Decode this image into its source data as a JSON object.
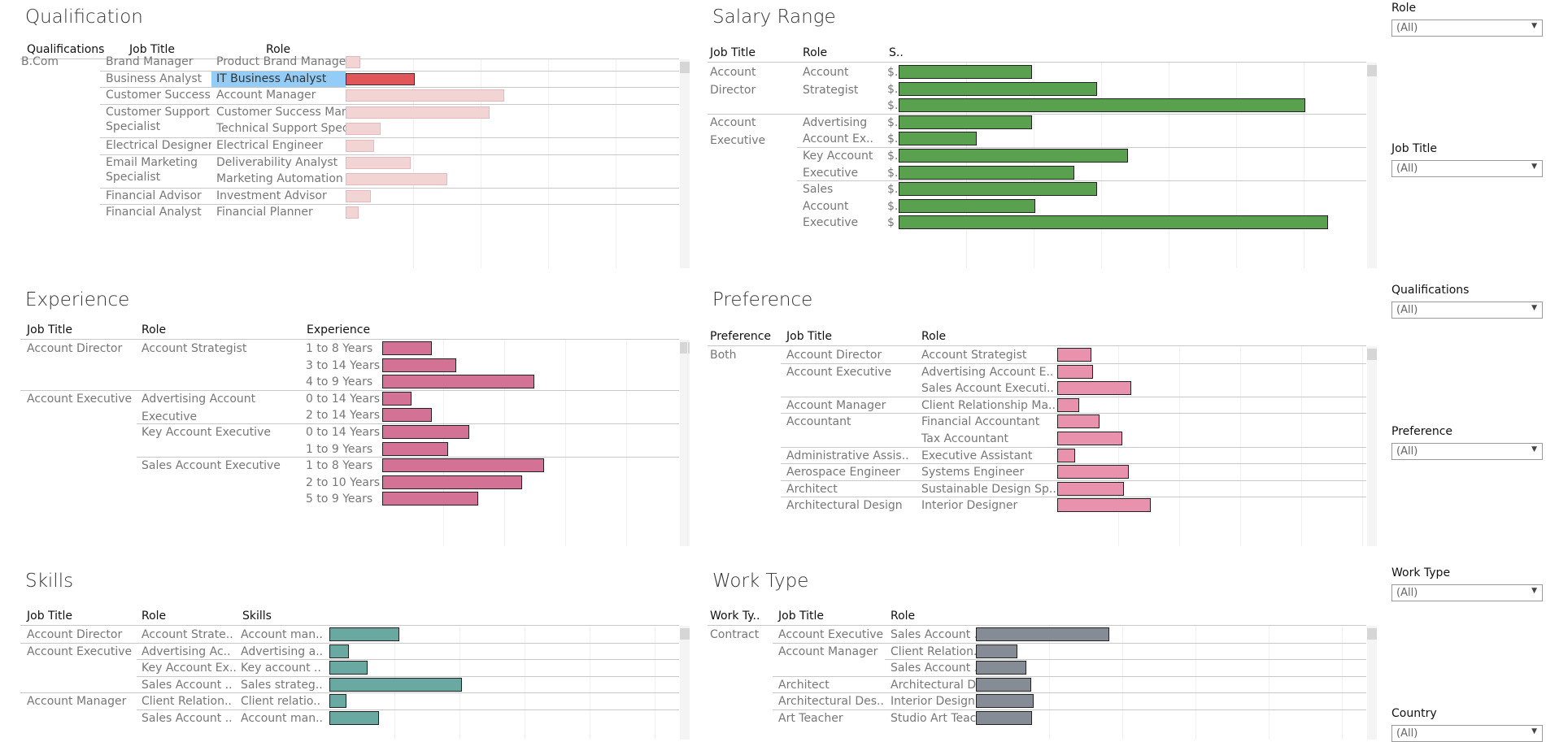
{
  "qualification": {
    "title": "Qualification",
    "headers": [
      "Qualifications",
      "Job Title",
      "Role"
    ],
    "rows": [
      {
        "qual": "B.Com",
        "job": "Brand Manager",
        "job2": "",
        "role": "Product Brand Manager",
        "value": 22
      },
      {
        "qual": "",
        "job": "Business Analyst",
        "job2": "",
        "role": "IT Business Analyst",
        "value": 104
      },
      {
        "qual": "",
        "job": "Customer Success M..",
        "job2": "",
        "role": "Account Manager",
        "value": 238
      },
      {
        "qual": "",
        "job": "Customer Support",
        "job2": "Specialist",
        "role": "Customer Success Manag..",
        "value": 216
      },
      {
        "qual": "",
        "job": "",
        "job2": "",
        "role": "Technical Support Special..",
        "value": 52
      },
      {
        "qual": "",
        "job": "Electrical Designer",
        "job2": "",
        "role": "Electrical Engineer",
        "value": 43
      },
      {
        "qual": "",
        "job": "Email Marketing",
        "job2": "Specialist",
        "role": "Deliverability Analyst",
        "value": 97
      },
      {
        "qual": "",
        "job": "",
        "job2": "",
        "role": "Marketing Automation Sp..",
        "value": 153
      },
      {
        "qual": "",
        "job": "Financial Advisor",
        "job2": "",
        "role": "Investment Advisor",
        "value": 38
      },
      {
        "qual": "",
        "job": "Financial Analyst",
        "job2": "",
        "role": "Financial Planner",
        "value": 19
      }
    ],
    "colors": {
      "highlight": "#e15759",
      "faded": "#f2d4d5",
      "selected_cell": "#93cdf7"
    }
  },
  "salary": {
    "title": "Salary Range",
    "headers": [
      "Job Title",
      "Role",
      "S.."
    ],
    "rows": [
      {
        "job": "Account",
        "job2": "Director",
        "role": "Account",
        "role2": "Strategist",
        "label": "$..",
        "value": 164
      },
      {
        "job": "",
        "job2": "",
        "role": "",
        "role2": "",
        "label": "$..",
        "value": 244
      },
      {
        "job": "",
        "job2": "",
        "role": "",
        "role2": "",
        "label": "$..",
        "value": 500
      },
      {
        "job": "Account",
        "job2": "Executive",
        "role": "Advertising",
        "role2": "",
        "label": "$..",
        "value": 164
      },
      {
        "job": "",
        "job2": "",
        "role": "Account Ex..",
        "role2": "",
        "label": "$..",
        "value": 96
      },
      {
        "job": "",
        "job2": "",
        "role": "Key Account",
        "role2": "",
        "label": "$..",
        "value": 282
      },
      {
        "job": "",
        "job2": "",
        "role": "Executive",
        "role2": "",
        "label": "$..",
        "value": 216
      },
      {
        "job": "",
        "job2": "",
        "role": "Sales",
        "role2": "",
        "label": "$..",
        "value": 244
      },
      {
        "job": "",
        "job2": "",
        "role": "Account",
        "role2": "",
        "label": "$..",
        "value": 168
      },
      {
        "job": "",
        "job2": "",
        "role": "Executive",
        "role2": "",
        "label": "$",
        "value": 528
      }
    ],
    "colors": {
      "bar": "#59a14f"
    }
  },
  "experience": {
    "title": "Experience",
    "headers": [
      "Job Title",
      "Role",
      "Experience"
    ],
    "rows": [
      {
        "job": "Account Director",
        "role": "Account Strategist",
        "role2": "",
        "exp": "1 to 8 Years",
        "value": 61
      },
      {
        "job": "",
        "role": "",
        "role2": "",
        "exp": "3 to 14 Years",
        "value": 91
      },
      {
        "job": "",
        "role": "",
        "role2": "",
        "exp": "4 to 9 Years",
        "value": 187
      },
      {
        "job": "Account Executive",
        "role": "Advertising Account",
        "role2": "Executive",
        "exp": "0 to 14 Years",
        "value": 36
      },
      {
        "job": "",
        "role": "",
        "role2": "",
        "exp": "2 to 14 Years",
        "value": 61
      },
      {
        "job": "",
        "role": "Key Account Executive",
        "role2": "",
        "exp": "0 to 14 Years",
        "value": 107
      },
      {
        "job": "",
        "role": "",
        "role2": "",
        "exp": "1 to 9 Years",
        "value": 81
      },
      {
        "job": "",
        "role": "Sales Account Executive",
        "role2": "",
        "exp": "1 to 8 Years",
        "value": 199
      },
      {
        "job": "",
        "role": "",
        "role2": "",
        "exp": "2 to 10 Years",
        "value": 172
      },
      {
        "job": "",
        "role": "",
        "role2": "",
        "exp": "5 to 9 Years",
        "value": 118
      }
    ],
    "colors": {
      "bar": "#d37295"
    }
  },
  "preference": {
    "title": "Preference",
    "headers": [
      "Preference",
      "Job Title",
      "Role"
    ],
    "rows": [
      {
        "pref": "Both",
        "job": "Account Director",
        "role": "Account Strategist",
        "value": 42
      },
      {
        "pref": "",
        "job": "Account Executive",
        "role": "Advertising Account E..",
        "value": 44
      },
      {
        "pref": "",
        "job": "",
        "role": "Sales Account Executi..",
        "value": 91
      },
      {
        "pref": "",
        "job": "Account Manager",
        "role": "Client Relationship Ma..",
        "value": 27
      },
      {
        "pref": "",
        "job": "Accountant",
        "role": "Financial Accountant",
        "value": 52
      },
      {
        "pref": "",
        "job": "",
        "role": "Tax Accountant",
        "value": 80
      },
      {
        "pref": "",
        "job": "Administrative Assis..",
        "role": "Executive Assistant",
        "value": 22
      },
      {
        "pref": "",
        "job": "Aerospace Engineer",
        "role": "Systems Engineer",
        "value": 88
      },
      {
        "pref": "",
        "job": "Architect",
        "role": "Sustainable Design Sp..",
        "value": 82
      },
      {
        "pref": "",
        "job": "Architectural Design",
        "role": "Interior Designer",
        "value": 115
      }
    ],
    "colors": {
      "bar": "#e892ae"
    }
  },
  "skills": {
    "title": "Skills",
    "headers": [
      "Job Title",
      "Role",
      "Skills"
    ],
    "rows": [
      {
        "job": "Account Director",
        "role": "Account Strate..",
        "skill": "Account man..",
        "value": 86
      },
      {
        "job": "Account Executive",
        "role": "Advertising Ac..",
        "skill": "Advertising a..",
        "value": 24
      },
      {
        "job": "",
        "role": "Key Account Ex..",
        "skill": "Key account ..",
        "value": 47
      },
      {
        "job": "",
        "role": "Sales Account ..",
        "skill": "Sales strateg..",
        "value": 163
      },
      {
        "job": "Account Manager",
        "role": "Client Relation..",
        "skill": "Client relatio..",
        "value": 21
      },
      {
        "job": "",
        "role": "Sales Account ..",
        "skill": "Account man..",
        "value": 61
      }
    ],
    "colors": {
      "bar": "#6aa8a2"
    }
  },
  "worktype": {
    "title": "Work Type",
    "headers": [
      "Work Ty..",
      "Job Title",
      "Role"
    ],
    "rows": [
      {
        "wt": "Contract",
        "job": "Account Executive",
        "role": "Sales Account ..",
        "value": 164
      },
      {
        "wt": "",
        "job": "Account Manager",
        "role": "Client Relation..",
        "value": 51
      },
      {
        "wt": "",
        "job": "",
        "role": "Sales Account ..",
        "value": 62
      },
      {
        "wt": "",
        "job": "Architect",
        "role": "Architectural D..",
        "value": 68
      },
      {
        "wt": "",
        "job": "Architectural Des..",
        "role": "Interior Design..",
        "value": 71
      },
      {
        "wt": "",
        "job": "Art Teacher",
        "role": "Studio Art Teac..",
        "value": 69
      }
    ],
    "colors": {
      "bar": "#858c96"
    }
  },
  "filters": [
    {
      "label": "Role",
      "value": "(All)"
    },
    {
      "label": "Job Title",
      "value": "(All)"
    },
    {
      "label": "Qualifications",
      "value": "(All)"
    },
    {
      "label": "Preference",
      "value": "(All)"
    },
    {
      "label": "Work Type",
      "value": "(All)"
    },
    {
      "label": "Country",
      "value": "(All)"
    }
  ]
}
